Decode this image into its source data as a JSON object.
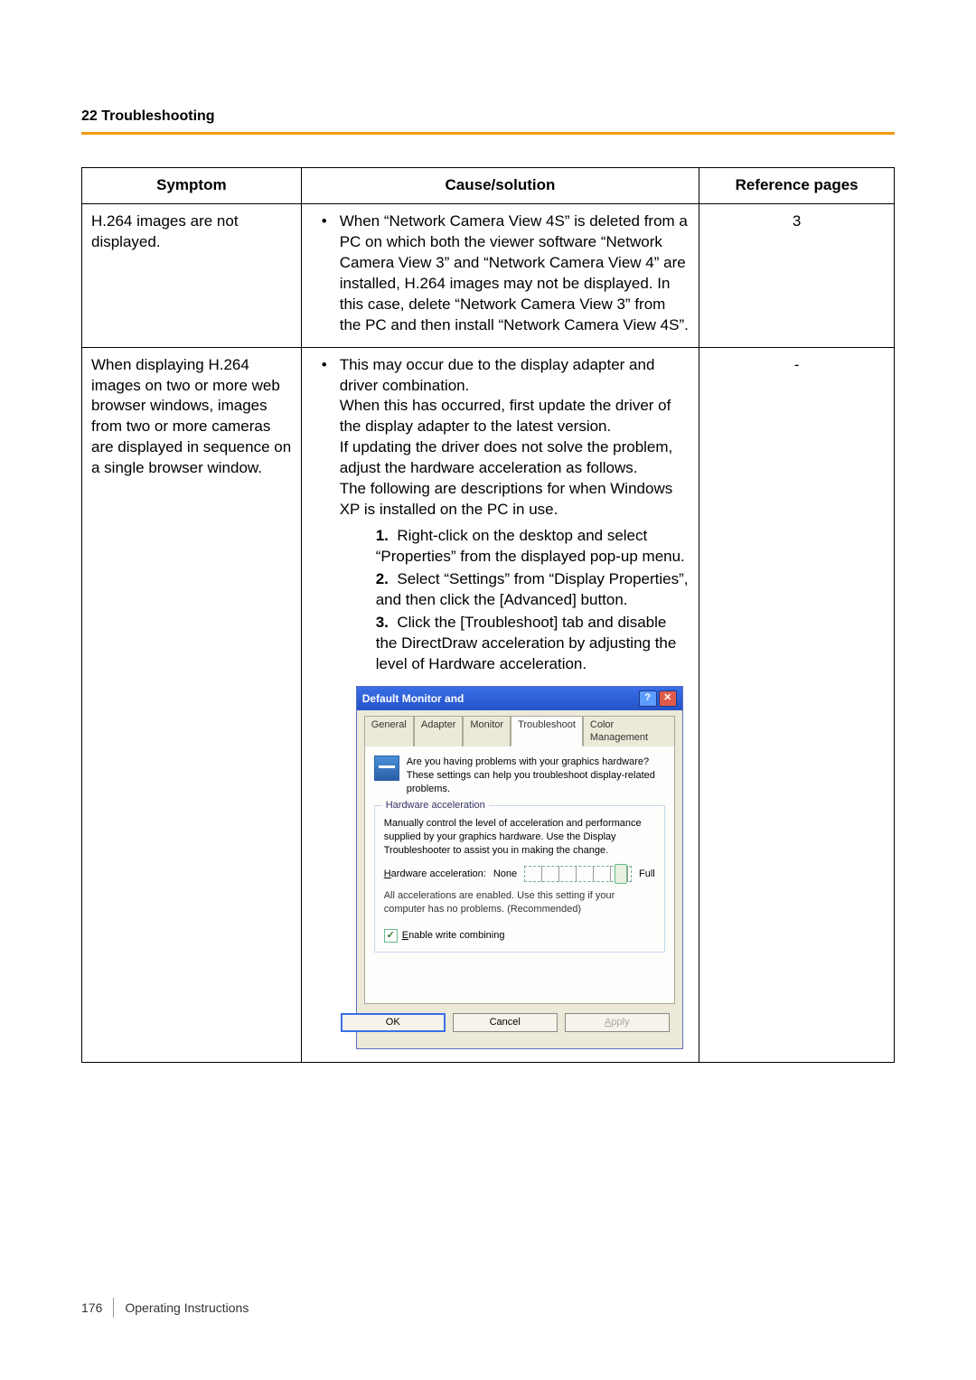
{
  "header": {
    "section": "22 Troubleshooting"
  },
  "table": {
    "headers": {
      "symptom": "Symptom",
      "cause": "Cause/solution",
      "ref": "Reference pages"
    },
    "rows": [
      {
        "symptom": "H.264 images are not displayed.",
        "cause": {
          "bullet": "When “Network Camera View 4S” is deleted from a PC on which both the viewer software “Network Camera View 3” and “Network Camera View 4” are installed, H.264 images may not be displayed. In this case, delete “Network Camera View 3” from the PC and then install “Network Camera View 4S”."
        },
        "ref": "3"
      },
      {
        "symptom": "When displaying H.264 images on two or more web browser windows, images from two or more cameras are displayed in sequence on a single browser window.",
        "cause": {
          "intro": "This may occur due to the display adapter and driver combination.\nWhen this has occurred, first update the driver of the display adapter to the latest version.\nIf updating the driver does not solve the problem, adjust the hardware acceleration as follows.\nThe following are descriptions for when Windows XP is installed on the PC in use.",
          "steps": [
            "Right-click on the desktop and select “Properties” from the displayed pop-up menu.",
            "Select “Settings” from “Display Properties”, and then click the [Advanced] button.",
            "Click the [Troubleshoot] tab and disable the DirectDraw acceleration by adjusting the level of Hardware acceleration."
          ]
        },
        "ref": "-"
      }
    ]
  },
  "dialog": {
    "title": "Default Monitor and",
    "tabs": {
      "general": "General",
      "adapter": "Adapter",
      "monitor": "Monitor",
      "troubleshoot": "Troubleshoot",
      "colorMgmt": "Color Management"
    },
    "info": "Are you having problems with your graphics hardware? These settings can help you troubleshoot display-related problems.",
    "group_title": "Hardware acceleration",
    "group_desc": "Manually control the level of acceleration and performance supplied by your graphics hardware. Use the Display Troubleshooter to assist you in making the change.",
    "slider_label": "Hardware acceleration:",
    "slider_none": "None",
    "slider_full": "Full",
    "note": "All accelerations are enabled. Use this setting if your computer has no problems. (Recommended)",
    "checkbox": "Enable write combining",
    "buttons": {
      "ok": "OK",
      "cancel": "Cancel",
      "apply": "Apply"
    }
  },
  "footer": {
    "page_number": "176",
    "doc_title": "Operating Instructions"
  }
}
